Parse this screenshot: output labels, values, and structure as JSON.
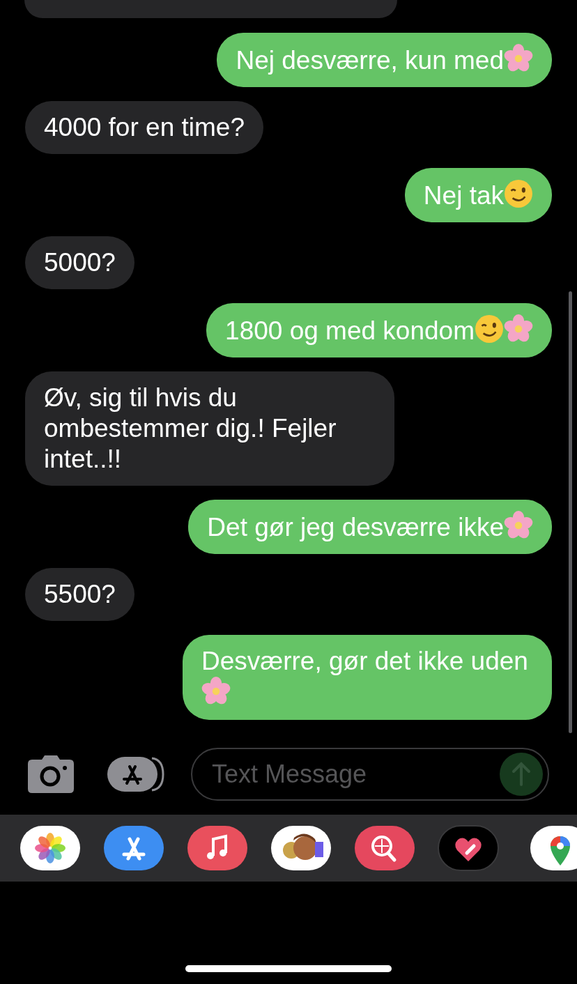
{
  "messages": [
    {
      "kind": "sent",
      "text": "Nej desværre, kun med",
      "emoji": [
        {
          "kind": "blossom"
        }
      ]
    },
    {
      "kind": "received",
      "text": "4000 for en time?"
    },
    {
      "kind": "sent",
      "text": "Nej tak",
      "emoji": [
        {
          "kind": "wink"
        }
      ]
    },
    {
      "kind": "received",
      "text": "5000?"
    },
    {
      "kind": "sent",
      "text": "1800 og med kondom",
      "emoji": [
        {
          "kind": "wink"
        },
        {
          "kind": "blossom"
        }
      ]
    },
    {
      "kind": "received",
      "text": "Øv, sig til hvis du ombestemmer dig.! Fejler intet..!!"
    },
    {
      "kind": "sent",
      "text": "Det gør jeg desværre ikke",
      "emoji": [
        {
          "kind": "blossom"
        }
      ]
    },
    {
      "kind": "received",
      "text": "5500?"
    },
    {
      "kind": "sent",
      "text": "Desværre, gør det ikke uden",
      "emoji": [
        {
          "kind": "blossom"
        }
      ]
    }
  ],
  "composer": {
    "placeholder": "Text Message"
  },
  "app_tray": [
    {
      "kind": "photos"
    },
    {
      "kind": "appstore"
    },
    {
      "kind": "music"
    },
    {
      "kind": "memoji"
    },
    {
      "kind": "search"
    },
    {
      "kind": "heart"
    },
    {
      "kind": "maps"
    }
  ]
}
